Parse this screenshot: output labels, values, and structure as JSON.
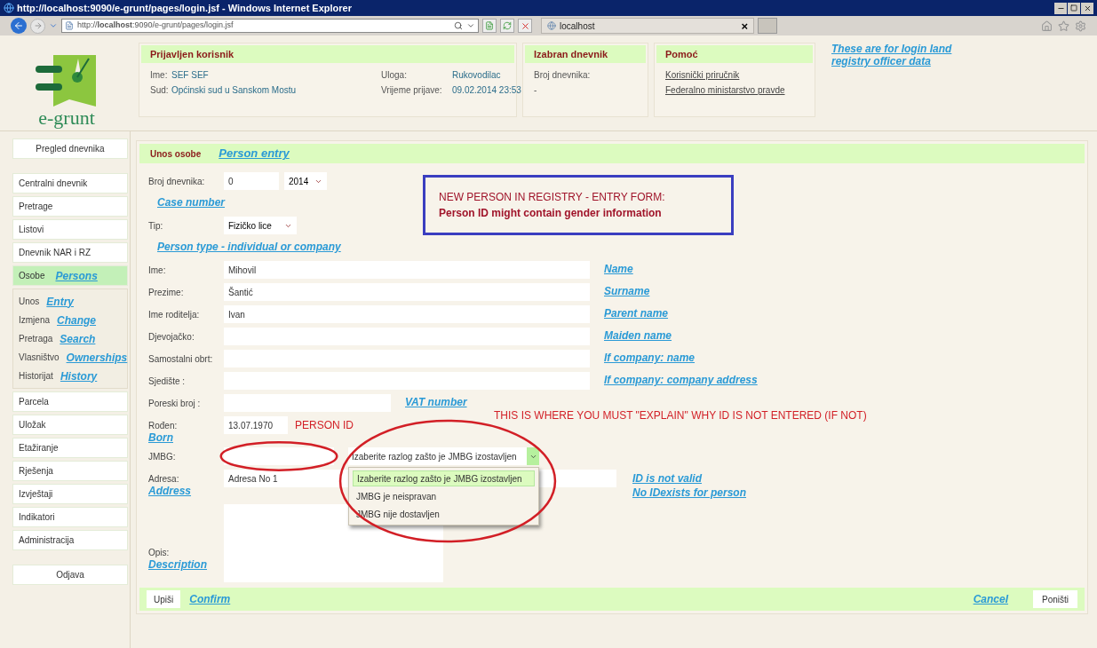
{
  "browser": {
    "title": "http://localhost:9090/e-grunt/pages/login.jsf - Windows Internet Explorer",
    "address": "http://**localhost**:9090/e-grunt/pages/login.jsf",
    "tab": "localhost",
    "tab_close": "×"
  },
  "logo": {
    "text": "e-grunt"
  },
  "header": {
    "user_panel": {
      "title": "Prijavljen korisnik",
      "fields": [
        {
          "label": "Ime:",
          "value": "SEF SEF"
        },
        {
          "label": "Uloga:",
          "value": "Rukovodilac"
        },
        {
          "label": "Sud:",
          "value": "Općinski sud u Sanskom Mostu"
        },
        {
          "label": "Vrijeme prijave:",
          "value": "09.02.2014 23:53"
        }
      ]
    },
    "journal_panel": {
      "title": "Izabran dnevnik",
      "label": "Broj dnevnika:",
      "value": "-"
    },
    "help_panel": {
      "title": "Pomoć",
      "links": [
        "Korisnički priručnik",
        "Federalno ministarstvo pravde"
      ]
    },
    "note": "These are for login land registry officer data"
  },
  "sidebar": {
    "groups": [
      {
        "kind": "single",
        "items": [
          {
            "label": "Pregled dnevnika",
            "selected": false
          }
        ]
      },
      {
        "kind": "menu",
        "items": [
          {
            "label": "Centralni dnevnik",
            "selected": false
          },
          {
            "label": "Pretrage",
            "selected": false
          },
          {
            "label": "Listovi",
            "selected": false
          },
          {
            "label": "Dnevnik NAR i RZ",
            "selected": false
          },
          {
            "label": "Osobe",
            "note": "Persons",
            "selected": true,
            "children": [
              {
                "label": "Unos",
                "note": "Entry",
                "selected": false
              },
              {
                "label": "Izmjena",
                "note": "Change",
                "selected": false
              },
              {
                "label": "Pretraga",
                "note": "Search",
                "selected": false
              },
              {
                "label": "Vlasništvo",
                "note": "Ownerships",
                "selected": false
              },
              {
                "label": "Historijat",
                "note": "History",
                "selected": false
              }
            ]
          },
          {
            "label": "Parcela",
            "selected": false
          },
          {
            "label": "Uložak",
            "selected": false
          },
          {
            "label": "Etažiranje",
            "selected": false
          },
          {
            "label": "Rješenja",
            "selected": false
          },
          {
            "label": "Izvještaji",
            "selected": false
          },
          {
            "label": "Indikatori",
            "selected": false
          },
          {
            "label": "Administracija",
            "selected": false
          }
        ]
      },
      {
        "kind": "single",
        "items": [
          {
            "label": "Odjava",
            "selected": false
          }
        ]
      }
    ]
  },
  "form": {
    "title": "Unos osobe",
    "note": "Person entry",
    "info_box": [
      "NEW PERSON IN REGISTRY - ENTRY FORM:",
      "Person ID might contain gender information"
    ],
    "rows": [
      {
        "kind": "case",
        "label": "Broj dnevnika:",
        "value": "0",
        "year": "2014",
        "label_note": "Case number"
      },
      {
        "kind": "select",
        "label": "Tip:",
        "value": "Fizičko lice",
        "label_note": "Person type - individual or company"
      },
      {
        "kind": "text",
        "label": "Ime:",
        "value": "Mihovil",
        "note": "Name"
      },
      {
        "kind": "text",
        "label": "Prezime:",
        "value": "Šantić",
        "note": "Surname"
      },
      {
        "kind": "text",
        "label": "Ime roditelja:",
        "value": "Ivan",
        "note": "Parent name"
      },
      {
        "kind": "text",
        "label": "Djevojačko:",
        "note": "Maiden name"
      },
      {
        "kind": "text",
        "label": "Samostalni obrt:",
        "note": "If company: name"
      },
      {
        "kind": "text",
        "label": "Sjedište :",
        "note": "If company: company address"
      },
      {
        "kind": "short",
        "label": "Poreski broj :",
        "note": "VAT number"
      },
      {
        "kind": "date",
        "label": "Rođen:",
        "value": "13.07.1970",
        "label_note": "Born",
        "callouts": [
          "PERSON ID",
          "THIS IS WHERE YOU MUST \"EXPLAIN\" WHY ID IS NOT ENTERED (IF NOT)"
        ]
      },
      {
        "kind": "jmbg",
        "label": "JMBG:",
        "reason": {
          "value": "Izaberite razlog zašto je JMBG izostavljen",
          "expanded": true,
          "options": [
            {
              "label": "Izaberite razlog zašto je JMBG izostavljen",
              "selected": true
            },
            {
              "label": "JMBG je neispravan",
              "selected": false
            },
            {
              "label": "JMBG nije dostavljen",
              "selected": false
            }
          ]
        }
      },
      {
        "kind": "address",
        "label": "Adresa:",
        "value": "Adresa No 1",
        "label_note": "Address",
        "notes": [
          "ID is not valid",
          "No IDexists for person"
        ]
      },
      {
        "kind": "textarea",
        "label": "Opis:",
        "label_note": "Description"
      }
    ],
    "confirm": {
      "label": "Upiši",
      "note": "Confirm"
    },
    "cancel": {
      "label": "Poništi",
      "note": "Cancel"
    }
  }
}
